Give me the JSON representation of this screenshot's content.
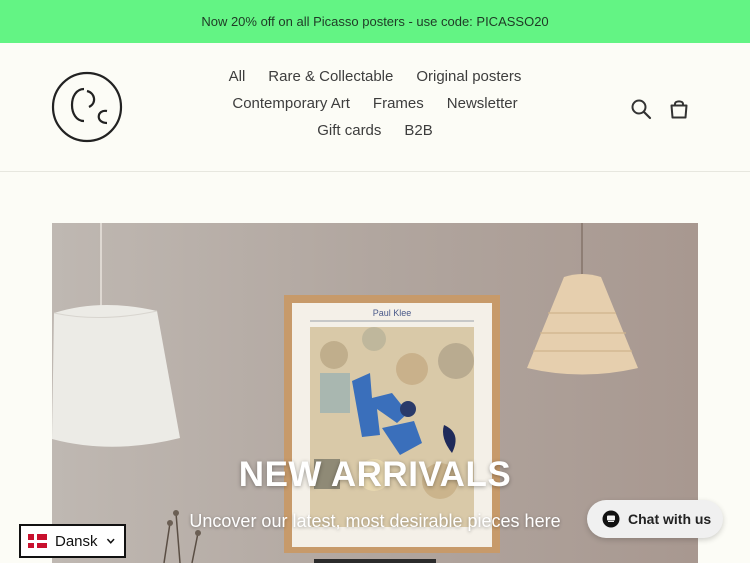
{
  "announcement": "Now 20% off on all Picasso posters - use code: PICASSO20",
  "nav": {
    "row1": [
      "All",
      "Rare & Collectable",
      "Original posters"
    ],
    "row2": [
      "Contemporary Art",
      "Frames",
      "Newsletter"
    ],
    "row3": [
      "Gift cards",
      "B2B"
    ]
  },
  "icons": {
    "search": "search-icon",
    "cart": "cart-icon",
    "logo": "logo-icon",
    "chat": "chat-bubble-icon",
    "flag": "denmark-flag-icon"
  },
  "poster_label": "Paul Klee",
  "hero": {
    "title": "NEW ARRIVALS",
    "subtitle": "Uncover our latest, most desirable pieces here"
  },
  "language": {
    "selected": "Dansk"
  },
  "chat": {
    "label": "Chat with us"
  },
  "colors": {
    "announcement_bg": "#63f484",
    "page_bg": "#fcfcf6"
  }
}
